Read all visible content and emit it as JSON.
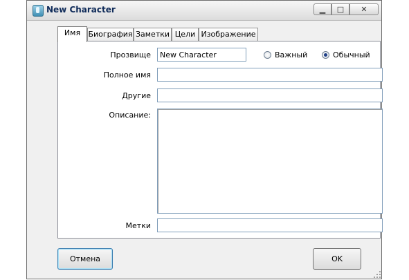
{
  "window": {
    "title": "New Character",
    "icons": {
      "app": "character-icon",
      "minimize": "minimize-icon",
      "maximize": "maximize-icon",
      "close": "close-icon"
    }
  },
  "tabs": [
    {
      "label": "Имя",
      "active": true
    },
    {
      "label": "Биография",
      "active": false
    },
    {
      "label": "Заметки",
      "active": false
    },
    {
      "label": "Цели",
      "active": false
    },
    {
      "label": "Изображение",
      "active": false
    }
  ],
  "form": {
    "nickname_label": "Прозвище",
    "nickname_value": "New Character",
    "important_label": "Важный",
    "ordinary_label": "Обычный",
    "selected_importance": "Обычный",
    "fullname_label": "Полное имя",
    "fullname_value": "",
    "other_label": "Другие",
    "other_value": "",
    "description_label": "Описание:",
    "description_value": "",
    "tags_label": "Метки",
    "tags_value": ""
  },
  "buttons": {
    "cancel": "Отмена",
    "ok": "OK"
  }
}
